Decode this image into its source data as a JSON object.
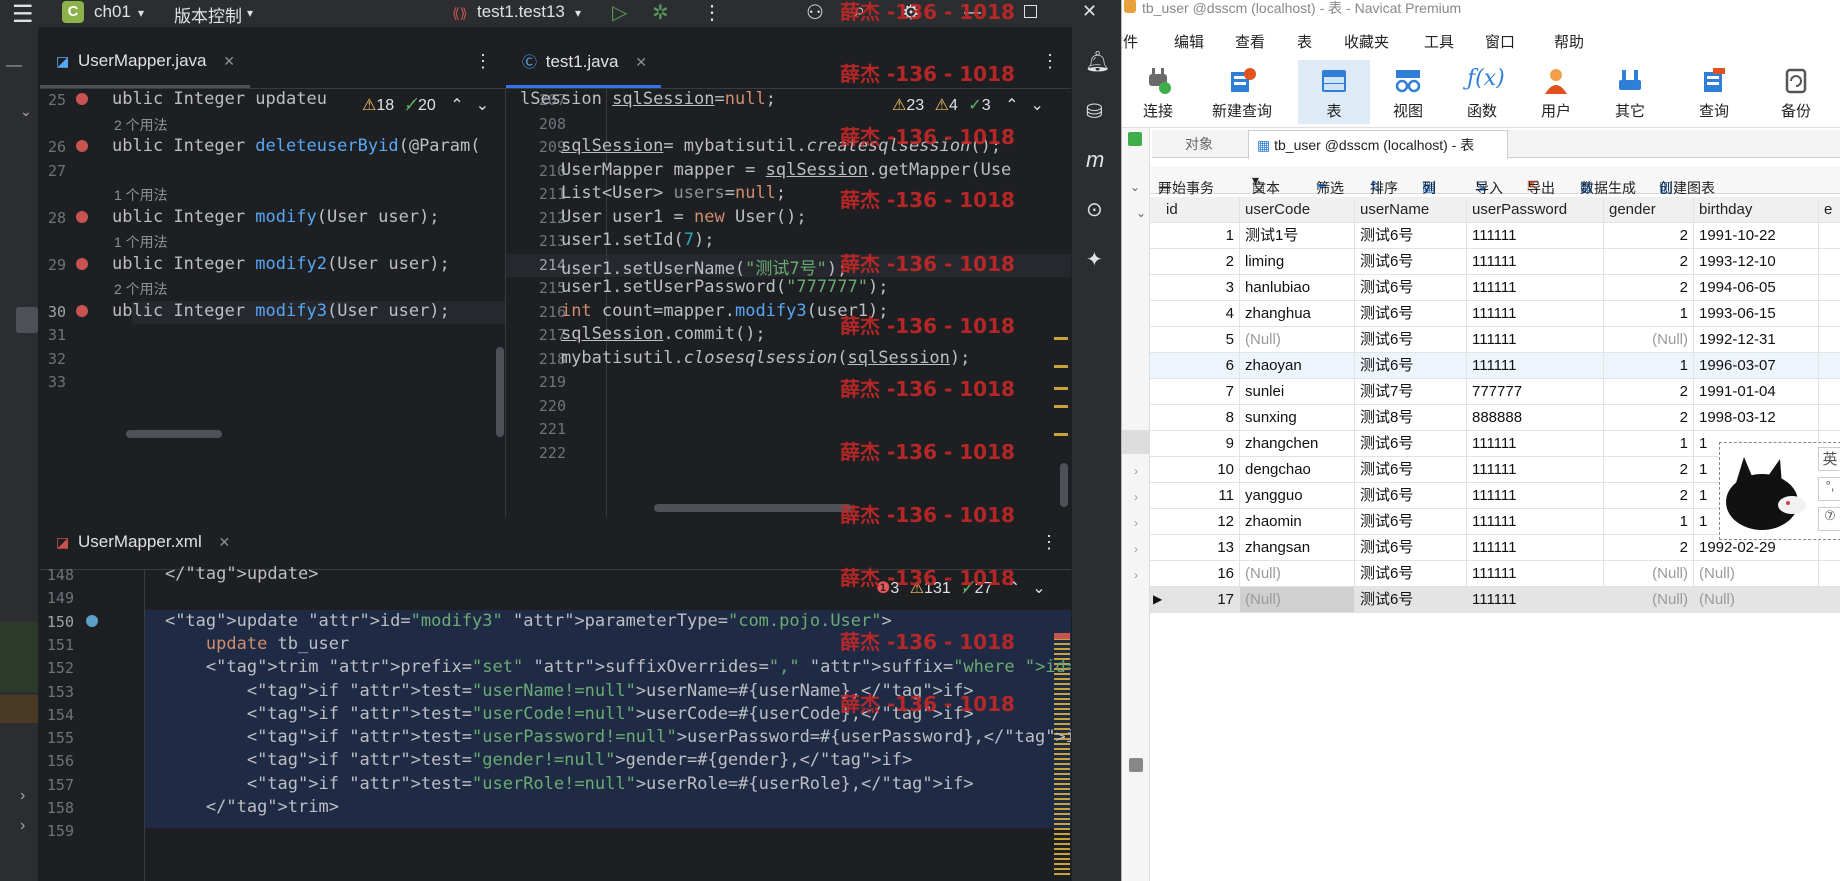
{
  "ide": {
    "project_badge": "C",
    "project_name": "ch01",
    "vcs_label": "版本控制",
    "run_config": "test1.test13",
    "top_tabs": [
      {
        "label": "UserMapper.java"
      },
      {
        "label": "test1.java"
      }
    ],
    "bottom_tab": {
      "label": "UserMapper.xml"
    },
    "left_pane": {
      "inspections": {
        "warnings": "18",
        "weak": "20"
      },
      "lines": [
        {
          "num": "25",
          "code": "ublic Integer updateu"
        },
        {
          "hint": "2 个用法"
        },
        {
          "num": "26",
          "code": "ublic Integer deleteuserByid(@Param("
        },
        {
          "num": "27",
          "code": ""
        },
        {
          "hint": "1 个用法"
        },
        {
          "num": "28",
          "code": "ublic Integer modify(User user);"
        },
        {
          "hint": "1 个用法"
        },
        {
          "num": "29",
          "code": "ublic Integer modify2(User user);"
        },
        {
          "hint": "2 个用法"
        },
        {
          "num": "30",
          "code": "ublic Integer modify3(User user);"
        },
        {
          "num": "31",
          "code": ""
        },
        {
          "num": "32",
          "code": ""
        },
        {
          "num": "33",
          "code": ""
        }
      ]
    },
    "middle_pane": {
      "inspections": {
        "warnings": "23",
        "weak": "4",
        "typos": "3"
      },
      "lines": [
        {
          "num": "207",
          "code": "lSession sqlSession=null;"
        },
        {
          "num": "208",
          "code": ""
        },
        {
          "num": "209",
          "code": "    sqlSession= mybatisutil.createsqlsession();"
        },
        {
          "num": "210",
          "code": "    UserMapper mapper = sqlSession.getMapper(Use"
        },
        {
          "num": "211",
          "code": "    List<User> users=null;"
        },
        {
          "num": "212",
          "code": "    User user1 = new User();"
        },
        {
          "num": "213",
          "code": "    user1.setId(7);"
        },
        {
          "num": "214",
          "code": "    user1.setUserName(\"测试7号\");"
        },
        {
          "num": "215",
          "code": "    user1.setUserPassword(\"777777\");"
        },
        {
          "num": "216",
          "code": "    int count=mapper.modify3(user1);"
        },
        {
          "num": "217",
          "code": "    sqlSession.commit();"
        },
        {
          "num": "218",
          "code": "    mybatisutil.closesqlsession(sqlSession);"
        },
        {
          "num": "219",
          "code": ""
        },
        {
          "num": "220",
          "code": ""
        },
        {
          "num": "221",
          "code": ""
        },
        {
          "num": "222",
          "code": ""
        }
      ]
    },
    "bottom_pane": {
      "inspections": {
        "errors": "3",
        "warnings": "131",
        "weak": "27"
      },
      "lines": [
        {
          "num": "148",
          "code": "    </update>"
        },
        {
          "num": "149",
          "code": ""
        },
        {
          "num": "150",
          "code": "    <update id=\"modify3\" parameterType=\"com.pojo.User\">"
        },
        {
          "num": "151",
          "code": "        update tb_user"
        },
        {
          "num": "152",
          "code": "        <trim prefix=\"set\" suffixOverrides=\",\" suffix=\"where id=#{id}\" >"
        },
        {
          "num": "153",
          "code": "            <if test=\"userName!=null\">userName=#{userName},</if>"
        },
        {
          "num": "154",
          "code": "            <if test=\"userCode!=null\">userCode=#{userCode},</if>"
        },
        {
          "num": "155",
          "code": "            <if test=\"userPassword!=null\">userPassword=#{userPassword},</if>"
        },
        {
          "num": "156",
          "code": "            <if test=\"gender!=null\">gender=#{gender},</if>"
        },
        {
          "num": "157",
          "code": "            <if test=\"userRole!=null\">userRole=#{userRole},</if>"
        },
        {
          "num": "158",
          "code": "        </trim>"
        },
        {
          "num": "159",
          "code": ""
        }
      ]
    },
    "watermark": "薛杰 -136 - 1018"
  },
  "navicat": {
    "title": "tb_user @dsscm (localhost) - 表 - Navicat Premium",
    "menu": [
      "文件",
      "编辑",
      "查看",
      "表",
      "收藏夹",
      "工具",
      "窗口",
      "帮助"
    ],
    "toolbar": [
      "连接",
      "新建查询",
      "表",
      "视图",
      "函数",
      "用户",
      "其它",
      "查询",
      "备份"
    ],
    "tabs": [
      "对象",
      "tb_user @dsscm (localhost) - 表"
    ],
    "actions": [
      "开始事务",
      "文本",
      "筛选",
      "排序",
      "列",
      "导入",
      "导出",
      "数据生成",
      "创建图表"
    ],
    "columns": [
      "id",
      "userCode",
      "userName",
      "userPassword",
      "gender",
      "birthday",
      "e"
    ],
    "null_text": "(Null)",
    "rows": [
      {
        "id": "1",
        "userCode": "测试1号",
        "userName": "测试6号",
        "userPassword": "111111",
        "gender": "2",
        "birthday": "1991-10-22"
      },
      {
        "id": "2",
        "userCode": "liming",
        "userName": "测试6号",
        "userPassword": "111111",
        "gender": "2",
        "birthday": "1993-12-10"
      },
      {
        "id": "3",
        "userCode": "hanlubiao",
        "userName": "测试6号",
        "userPassword": "111111",
        "gender": "2",
        "birthday": "1994-06-05"
      },
      {
        "id": "4",
        "userCode": "zhanghua",
        "userName": "测试6号",
        "userPassword": "111111",
        "gender": "1",
        "birthday": "1993-06-15"
      },
      {
        "id": "5",
        "userCode": "(Null)",
        "userName": "测试6号",
        "userPassword": "111111",
        "gender": "(Null)",
        "birthday": "1992-12-31"
      },
      {
        "id": "6",
        "userCode": "zhaoyan",
        "userName": "测试6号",
        "userPassword": "111111",
        "gender": "1",
        "birthday": "1996-03-07"
      },
      {
        "id": "7",
        "userCode": "sunlei",
        "userName": "测试7号",
        "userPassword": "777777",
        "gender": "2",
        "birthday": "1991-01-04"
      },
      {
        "id": "8",
        "userCode": "sunxing",
        "userName": "测试8号",
        "userPassword": "888888",
        "gender": "2",
        "birthday": "1998-03-12"
      },
      {
        "id": "9",
        "userCode": "zhangchen",
        "userName": "测试6号",
        "userPassword": "111111",
        "gender": "1",
        "birthday": "1"
      },
      {
        "id": "10",
        "userCode": "dengchao",
        "userName": "测试6号",
        "userPassword": "111111",
        "gender": "2",
        "birthday": "1"
      },
      {
        "id": "11",
        "userCode": "yangguo",
        "userName": "测试6号",
        "userPassword": "111111",
        "gender": "2",
        "birthday": "1"
      },
      {
        "id": "12",
        "userCode": "zhaomin",
        "userName": "测试6号",
        "userPassword": "111111",
        "gender": "1",
        "birthday": "1"
      },
      {
        "id": "13",
        "userCode": "zhangsan",
        "userName": "测试6号",
        "userPassword": "111111",
        "gender": "2",
        "birthday": "1992-02-29"
      },
      {
        "id": "16",
        "userCode": "(Null)",
        "userName": "测试6号",
        "userPassword": "111111",
        "gender": "(Null)",
        "birthday": "(Null)"
      },
      {
        "id": "17",
        "userCode": "(Null)",
        "userName": "测试6号",
        "userPassword": "111111",
        "gender": "(Null)",
        "birthday": "(Null)"
      }
    ],
    "popup_glyphs": [
      "英",
      "°,",
      "⑦"
    ]
  }
}
